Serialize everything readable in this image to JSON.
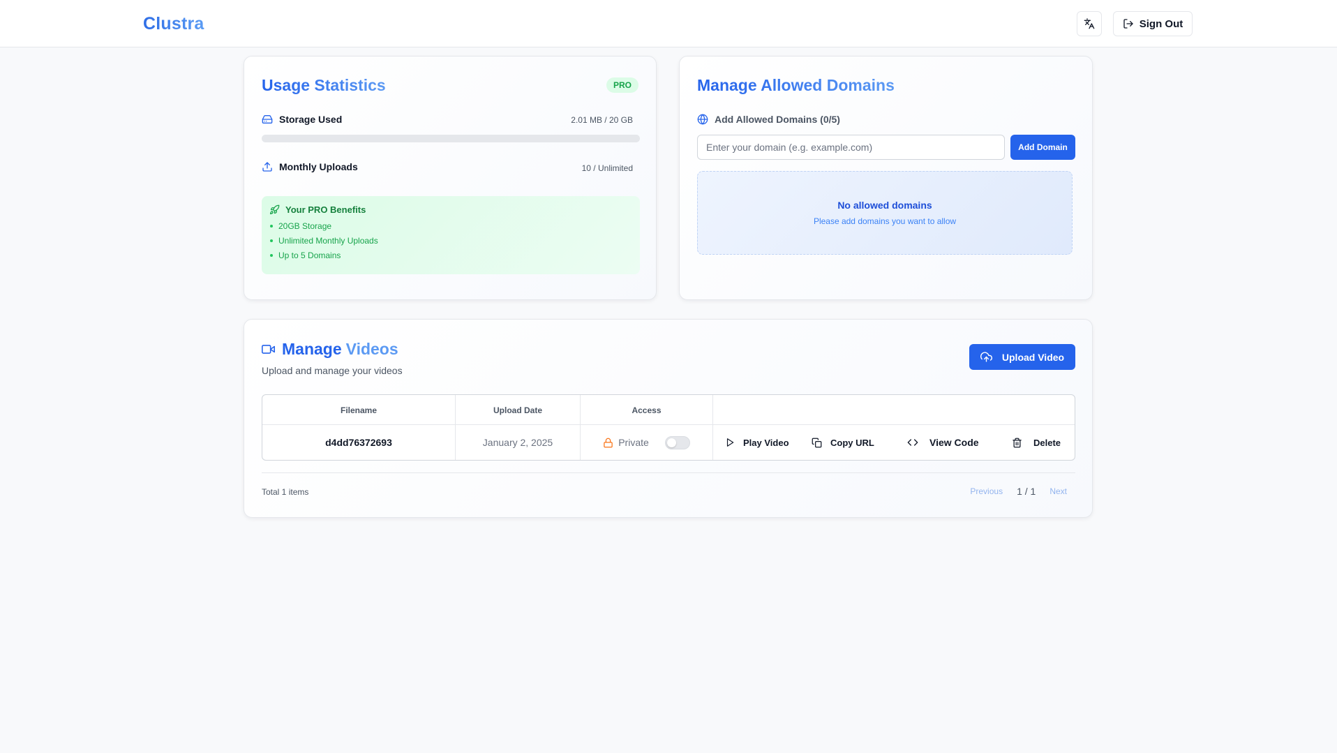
{
  "header": {
    "logo": "Clustra",
    "translate_icon": "translate-icon",
    "signout_label": "Sign Out",
    "signout_icon": "logout-icon"
  },
  "usage": {
    "title": "Usage Statistics",
    "badge": "PRO",
    "storage": {
      "label": "Storage Used",
      "value": "2.01 MB / 20 GB",
      "icon": "hard-drive-icon",
      "fill_fraction": 0.0001
    },
    "uploads": {
      "label": "Monthly Uploads",
      "value": "10 / Unlimited",
      "icon": "upload-icon"
    },
    "benefits": {
      "title": "Your PRO Benefits",
      "icon": "rocket-icon",
      "items": [
        "20GB Storage",
        "Unlimited Monthly Uploads",
        "Up to 5 Domains"
      ]
    }
  },
  "domains": {
    "title": "Manage Allowed Domains",
    "subheader": "Add Allowed Domains (0/5)",
    "subheader_icon": "globe-icon",
    "input_placeholder": "Enter your domain (e.g. example.com)",
    "add_button": "Add Domain",
    "empty_title": "No allowed domains",
    "empty_subtitle": "Please add domains you want to allow"
  },
  "videos": {
    "title_part1": "Manage",
    "title_part2": "Videos",
    "title_icon": "video-camera-icon",
    "subtitle": "Upload and manage your videos",
    "upload_button": "Upload Video",
    "upload_icon": "cloud-upload-icon",
    "columns": [
      "Filename",
      "Upload Date",
      "Access"
    ],
    "rows": [
      {
        "filename": "d4dd76372693",
        "date": "January 2, 2025",
        "access": "Private",
        "access_icon": "lock-icon",
        "public": false,
        "actions": {
          "play": "Play Video",
          "copy": "Copy URL",
          "code": "View Code",
          "delete": "Delete"
        }
      }
    ],
    "total": "Total 1 items",
    "pagination": {
      "previous": "Previous",
      "page": "1 / 1",
      "next": "Next"
    }
  },
  "colors": {
    "primary": "#2563eb",
    "success": "#16a34a",
    "warning": "#f97316"
  }
}
